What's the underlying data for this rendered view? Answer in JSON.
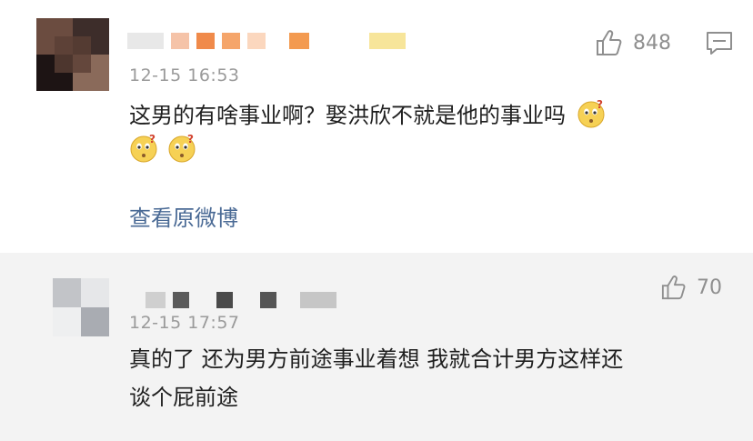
{
  "comments": [
    {
      "time": "12-15 16:53",
      "text": "这男的有啥事业啊？娶洪欣不就是他的事业吗",
      "likes": "848",
      "view_original": "查看原微博",
      "icons": {
        "like": "thumbs-up-icon",
        "reply": "comment-icon",
        "emoji": "confused-face-emoji"
      },
      "emoji_count": 3
    },
    {
      "time": "12-15 17:57",
      "text_line1": "真的了 还为男方前途事业着想 我就合计男方这样还",
      "text_line2": "谈个屁前途",
      "likes": "70",
      "icons": {
        "like": "thumbs-up-icon"
      }
    }
  ],
  "colors": {
    "link": "#4a6a95",
    "meta": "#9a9a9a",
    "reply_bg": "#f3f3f3"
  }
}
